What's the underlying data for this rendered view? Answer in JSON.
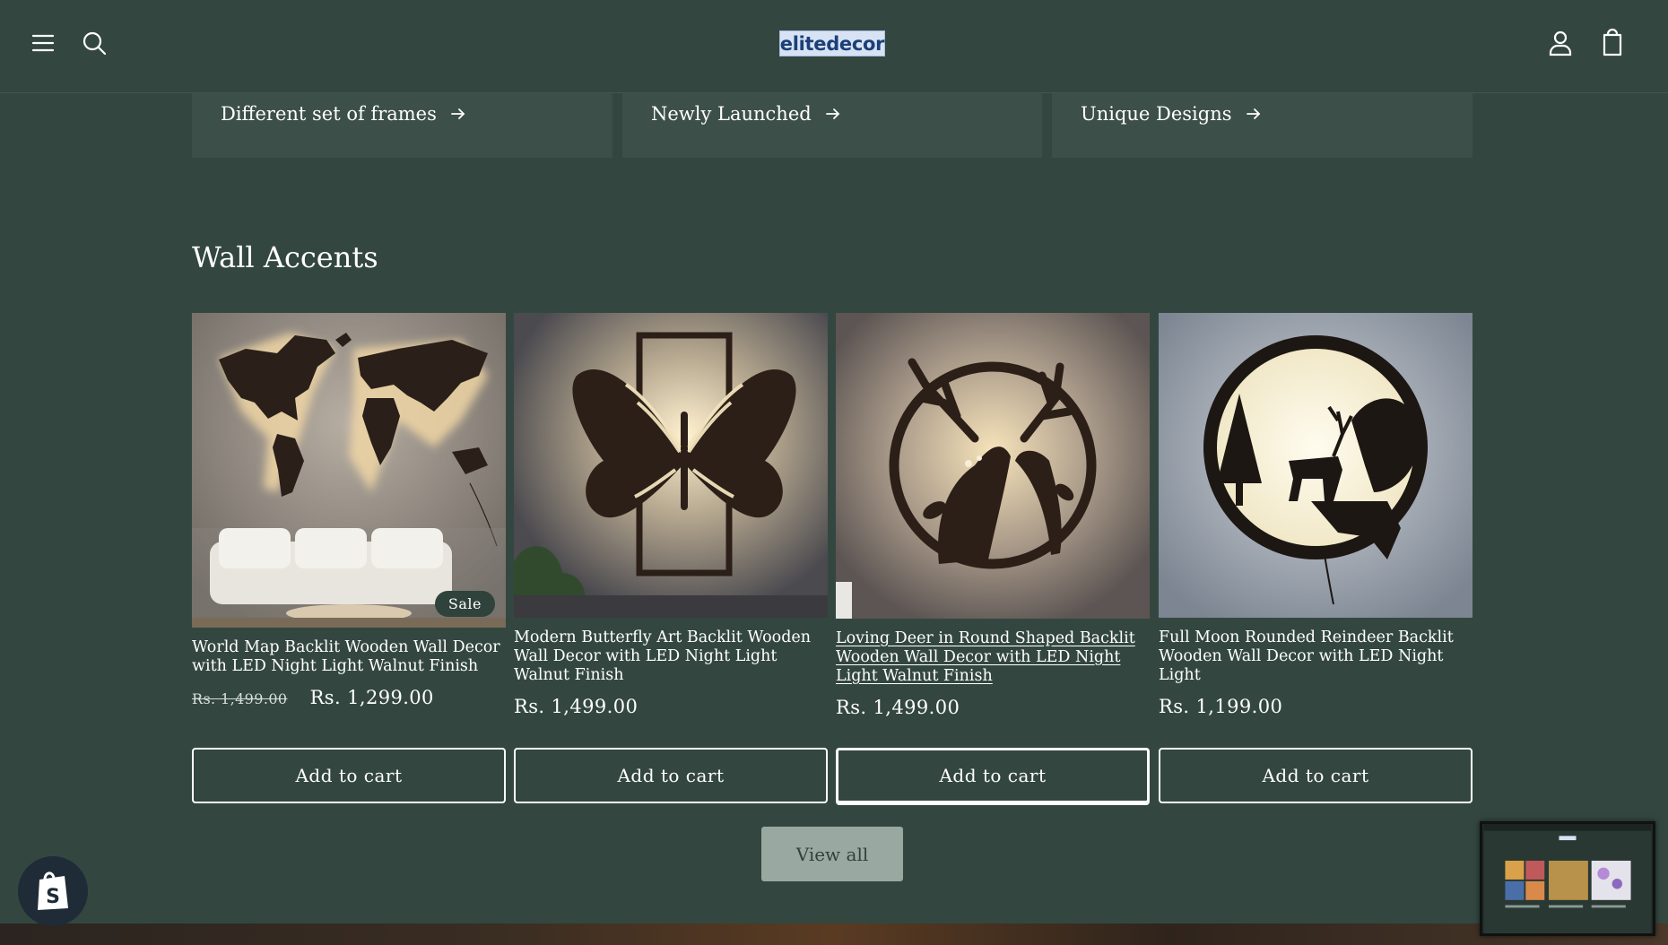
{
  "header": {
    "logo_text": "elitedecor",
    "icons": [
      "menu-icon",
      "search-icon",
      "account-icon",
      "cart-icon"
    ]
  },
  "collections": [
    {
      "label": "Different set of frames"
    },
    {
      "label": "Newly Launched"
    },
    {
      "label": "Unique Designs"
    }
  ],
  "section": {
    "title": "Wall Accents"
  },
  "products": [
    {
      "title": "World Map Backlit Wooden Wall Decor with LED Night Light Walnut Finish",
      "badge": "Sale",
      "price_old": "Rs. 1,499.00",
      "price": "Rs. 1,299.00",
      "button": "Add to cart"
    },
    {
      "title": "Modern Butterfly Art Backlit Wooden Wall Decor with LED Night Light Walnut Finish",
      "price": "Rs. 1,499.00",
      "button": "Add to cart"
    },
    {
      "title": "Loving Deer in Round Shaped Backlit Wooden Wall Decor with LED Night Light Walnut Finish",
      "price": "Rs. 1,499.00",
      "button": "Add to cart"
    },
    {
      "title": "Full Moon Rounded Reindeer Backlit Wooden Wall Decor with LED Night Light",
      "price": "Rs. 1,199.00",
      "button": "Add to cart"
    }
  ],
  "view_all_label": "View all",
  "colors": {
    "background": "#334740",
    "card": "#3c4f48",
    "button_secondary": "#9aa8a2",
    "logo_bg": "#d7e3f4",
    "logo_text": "#1c3f77"
  }
}
